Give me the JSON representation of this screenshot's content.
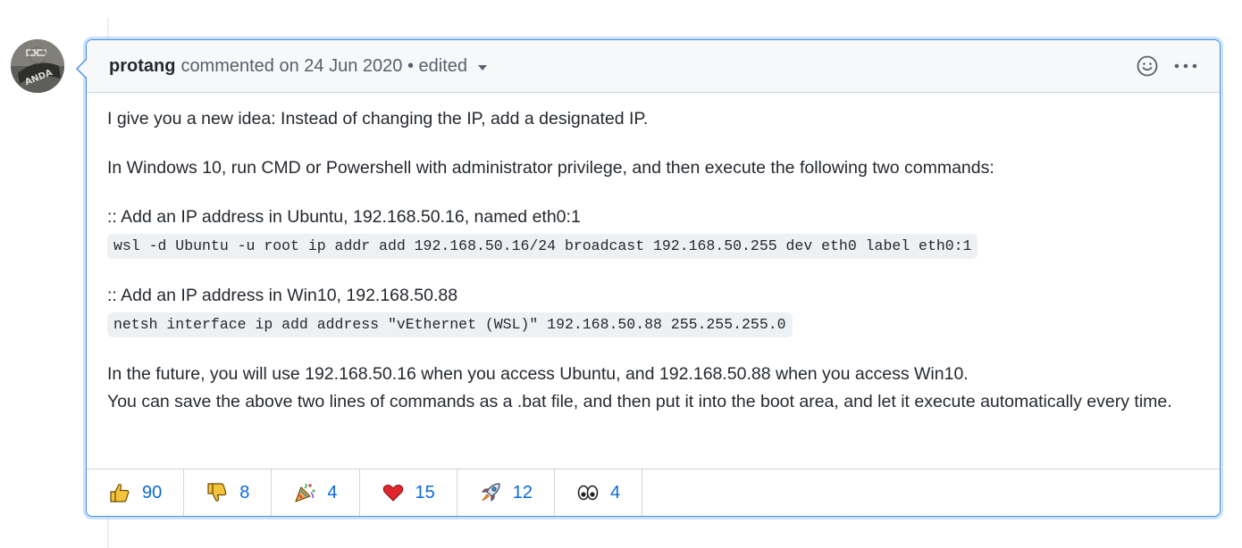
{
  "comment": {
    "author": "protang",
    "meta": "commented on 24 Jun 2020 • edited",
    "body": {
      "p1": "I give you a new idea: Instead of changing the IP, add a designated IP.",
      "p2": "In Windows 10, run CMD or Powershell with administrator privilege, and then execute the following two commands:",
      "step1_label": ":: Add an IP address in Ubuntu, 192.168.50.16, named eth0:1",
      "step1_code": "wsl -d Ubuntu -u root ip addr add 192.168.50.16/24 broadcast 192.168.50.255 dev eth0 label eth0:1",
      "step2_label": ":: Add an IP address in Win10, 192.168.50.88",
      "step2_code": "netsh interface ip add address \"vEthernet (WSL)\" 192.168.50.88 255.255.255.0",
      "p3_line1": "In the future, you will use 192.168.50.16 when you access Ubuntu, and 192.168.50.88 when you access Win10.",
      "p3_line2": "You can save the above two lines of commands as a .bat file, and then put it into the boot area, and let it execute automatically every time."
    },
    "reactions": [
      {
        "icon": "thumbs-up-icon",
        "count": "90"
      },
      {
        "icon": "thumbs-down-icon",
        "count": "8"
      },
      {
        "icon": "party-popper-icon",
        "count": "4"
      },
      {
        "icon": "heart-icon",
        "count": "15"
      },
      {
        "icon": "rocket-icon",
        "count": "12"
      },
      {
        "icon": "eyes-icon",
        "count": "4"
      }
    ]
  },
  "colors": {
    "focus_border": "#4a90e2",
    "link_blue": "#0969da",
    "header_bg": "#f6f8fa",
    "code_bg": "#eef1f4"
  }
}
